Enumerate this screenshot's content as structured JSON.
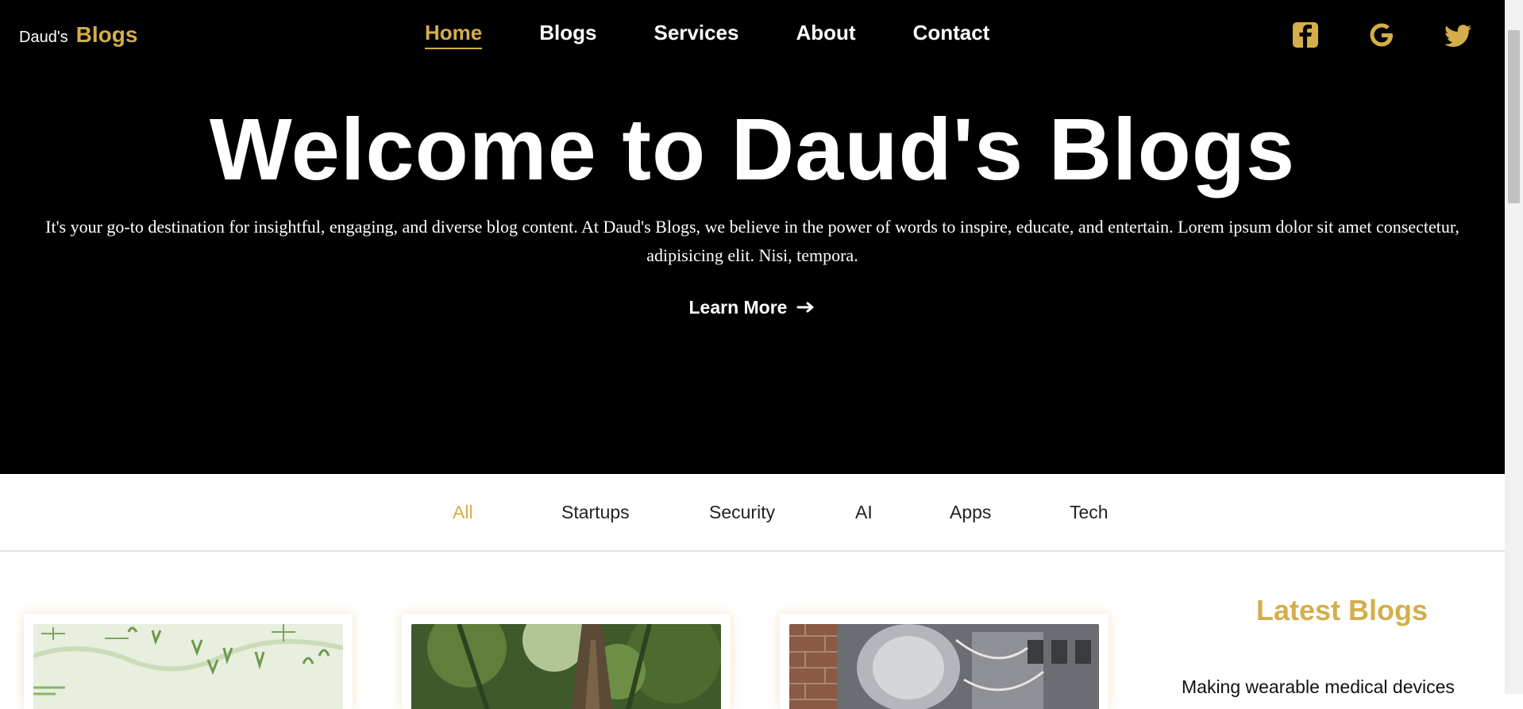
{
  "brand": {
    "prefix": "Daud's",
    "name": "Blogs",
    "accent": "#d4ae4a"
  },
  "nav": {
    "items": [
      {
        "label": "Home",
        "active": true
      },
      {
        "label": "Blogs"
      },
      {
        "label": "Services"
      },
      {
        "label": "About"
      },
      {
        "label": "Contact"
      }
    ]
  },
  "social": {
    "icons": [
      "facebook-icon",
      "google-icon",
      "twitter-icon"
    ]
  },
  "hero": {
    "title": "Welcome to Daud's Blogs",
    "description": "It's your go-to destination for insightful, engaging, and diverse blog content. At Daud's Blogs, we believe in the power of words to inspire, educate, and entertain. Lorem ipsum dolor sit amet consectetur, adipisicing elit. Nisi, tempora.",
    "cta_label": "Learn More"
  },
  "filters": {
    "tabs": [
      {
        "label": "All",
        "active": true
      },
      {
        "label": "Startups"
      },
      {
        "label": "Security"
      },
      {
        "label": "AI"
      },
      {
        "label": "Apps"
      },
      {
        "label": "Tech"
      }
    ]
  },
  "sidebar": {
    "title": "Latest Blogs",
    "items": [
      {
        "label": "Making wearable medical devices"
      }
    ]
  }
}
